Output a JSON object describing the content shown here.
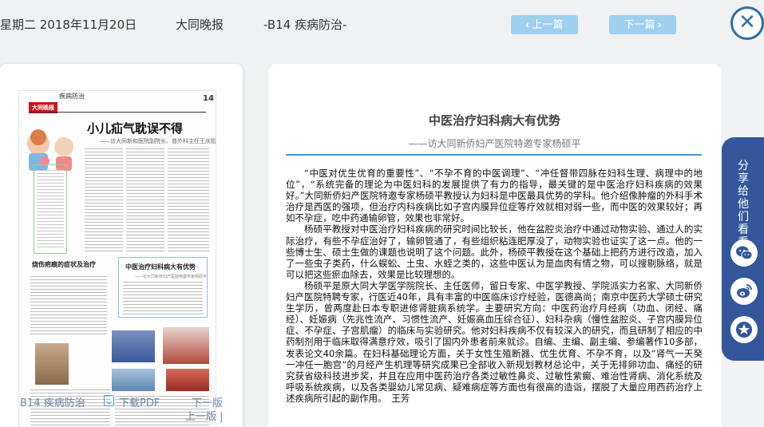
{
  "header": {
    "date": "星期二 2018年11月20日",
    "paper": "大同晚报",
    "section": "-B14 疾病防治-",
    "prev_label": "上一篇",
    "next_label": "下一篇"
  },
  "thumbnail": {
    "logo": "大同晚报",
    "section_name": "疾病防治",
    "page_number": "14",
    "headline": "小儿疝气耽误不得",
    "subhead": "——访大同新和医院副院长、普外科主任王庆松",
    "left_head": "烧伤疤痕的症状及治疗",
    "right_head": "中医治疗妇科病大有优势",
    "right_sub": "——访大同新侨妇产医院特邀专家杨硕平"
  },
  "footer": {
    "current_page": "B14 疾病防治",
    "download_pdf": "下载PDF",
    "next_page": "下一版",
    "prev_page": "上一版 |"
  },
  "article": {
    "title": "中医治疗妇科病大有优势",
    "subtitle": "——访大同新侨妇产医院特邀专家杨硕平",
    "paragraphs": [
      "“中医对优生优育的重要性”、“不孕不育的中医调理”、“冲任督带四脉在妇科生理、病理中的地位”，“系统完备的理论为中医妇科的发展提供了有力的指导，最关键的是中医治疗妇科疾病的效果好。”大同新侨妇产医院特邀专家杨硕平教授认为妇科是中医最具优势的学科。他介绍像肿瘤的外科手术治疗是西医的强项，但治疗内科疾病比如子宫内膜异位症等疗效就相对弱一些，而中医的效果较好；再如不孕症，吃中药通输卵管，效果也非常好。",
      "杨硕平教授对中医治疗妇科疾病的研究时间比较长，他在盆腔炎治疗中通过动物实验、通过人的实际治疗，有些不孕症治好了，输卵管通了，有些组织粘连肥厚没了，动物实验也证实了这一点。他的一些博士生、硕士生做的课题也说明了这个问题。此外，杨硕平教授在这个基础上把药方进行改造，加入了一些虫子类药，什么蜈蚣、土虫、水蛭之类的，这些中医认为是血肉有情之物，可以搜剔脉络，就是可以把这些瘀血除去，效果是比较理想的。",
      "杨硕平是原大同大学医学院院长、主任医师，留日专家、中医学教授、学院派实力名家、大同新侨妇产医院特聘专家，行医近40年，具有丰富的中医临床诊疗经验，医德高尚；南京中医药大学硕士研究生学历，曾两度赴日本专职进修肾脏病系统学。主要研究方向：中医药治疗月经病（功血、闭经、痛经）、妊娠病（先兆性流产、习惯性流产、妊娠高血压综合征）、妇科杂病（慢性盆腔炎、子宫内膜异位症、不孕症、子宫肌瘤）的临床与实验研究。他对妇科疾病不仅有较深入的研究，而且研制了相应的中药制剂用于临床取得满意疗效，吸引了国内外患者前来就诊。自编、主编、副主编、参编著作10多部，发表论文40余篇。在妇科基础理论方面，关于女性生殖断器、优生优育、不孕不育，以及“肾气一天癸一冲任一胞宫”的月经产生机理等研究成果已全部收入新规划教材总论中，关于无排卵功血、痛经的研究获省级科技进步奖，并且在应用中医药治疗各类过敏性鼻炎、过敏性紫癜、难治性肾病、消化系统及呼吸系统疾病，以及各类婴幼儿常见病、疑难病症等方面也有很高的造诣，摆脱了大量应用西药治疗上述疾病所引起的副作用。　王芳"
    ]
  },
  "share": {
    "label": "分享给他们看看",
    "icons": [
      "wechat-icon",
      "weibo-icon",
      "favorite-icon"
    ]
  },
  "colors": {
    "accent": "#3d9ad8",
    "nav_button": "#9fd0ee",
    "share_bg": "#33579a",
    "close": "#2f6fa3",
    "logo": "#c8161d"
  }
}
